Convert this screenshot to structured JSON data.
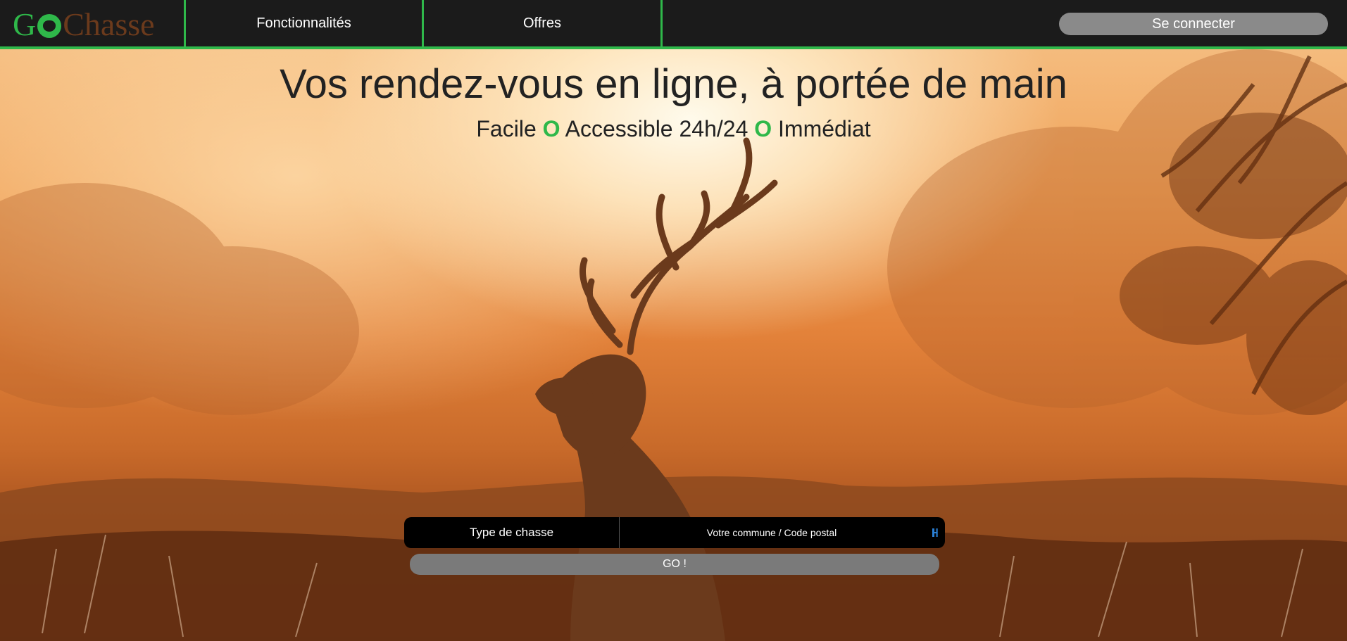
{
  "logo": {
    "text_g": "G",
    "text_rest": "Chasse"
  },
  "nav": {
    "items": [
      {
        "label": "Fonctionnalités"
      },
      {
        "label": "Offres"
      }
    ],
    "login_label": "Se connecter"
  },
  "hero": {
    "headline": "Vos rendez-vous en ligne, à portée de main",
    "tagline": {
      "part1": "Facile",
      "sep": "O",
      "part2": "Accessible 24h/24",
      "part3": "Immédiat"
    }
  },
  "search": {
    "hunt_type_label": "Type de chasse",
    "commune_placeholder": "Votre commune / Code postal",
    "go_label": "GO !"
  },
  "colors": {
    "accent": "#2fb84a",
    "header_bg": "#1b1b1b",
    "button_gray": "#8a8a8a"
  },
  "icons": [
    "deer-head-logo-icon",
    "locate-icon"
  ]
}
